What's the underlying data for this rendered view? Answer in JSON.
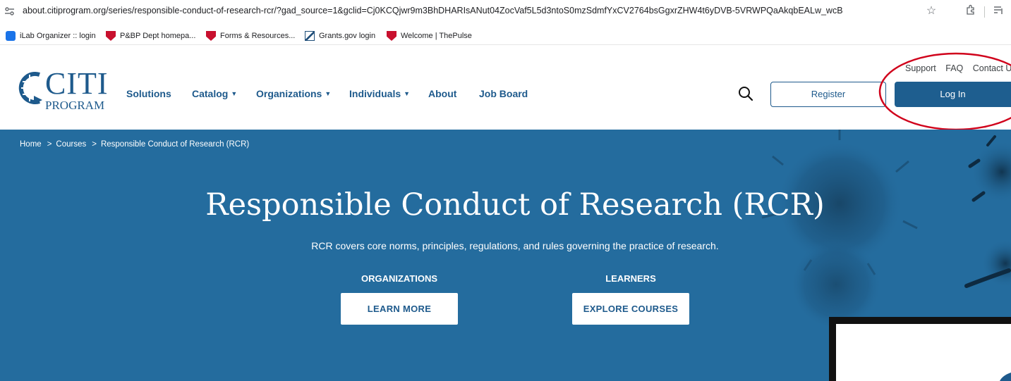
{
  "browser": {
    "url": "about.citiprogram.org/series/responsible-conduct-of-research-rcr/?gad_source=1&gclid=Cj0KCQjwr9m3BhDHARIsANut04ZocVaf5L5d3ntoS0mzSdmfYxCV2764bsGgxrZHW4t6yDVB-5VRWPQaAkqbEALw_wcB",
    "bookmarks": [
      {
        "label": "iLab Organizer :: login",
        "icon": "ilab-icon"
      },
      {
        "label": "P&BP Dept homepa...",
        "icon": "shield-icon"
      },
      {
        "label": "Forms & Resources...",
        "icon": "shield-icon"
      },
      {
        "label": "Grants.gov login",
        "icon": "grants-icon"
      },
      {
        "label": "Welcome | ThePulse",
        "icon": "shield-icon"
      }
    ]
  },
  "header": {
    "logo_main": "CITI",
    "logo_sub": "PROGRAM",
    "nav": [
      {
        "label": "Solutions",
        "dropdown": false
      },
      {
        "label": "Catalog",
        "dropdown": true
      },
      {
        "label": "Organizations",
        "dropdown": true
      },
      {
        "label": "Individuals",
        "dropdown": true
      },
      {
        "label": "About",
        "dropdown": false
      },
      {
        "label": "Job Board",
        "dropdown": false
      }
    ],
    "utility": {
      "support": "Support",
      "faq": "FAQ",
      "contact": "Contact Us"
    },
    "register_label": "Register",
    "login_label": "Log In"
  },
  "hero": {
    "breadcrumb": {
      "home": "Home",
      "courses": "Courses",
      "current": "Responsible Conduct of Research (RCR)",
      "separator": ">"
    },
    "title": "Responsible Conduct of Research (RCR)",
    "subtitle": "RCR covers core norms, principles, regulations, and rules governing the practice of research.",
    "organizations_label": "ORGANIZATIONS",
    "learn_more_label": "LEARN MORE",
    "learners_label": "LEARNERS",
    "explore_label": "EXPLORE COURSES"
  },
  "colors": {
    "brand_blue": "#1e5a8c",
    "hero_blue": "#246c9e",
    "annotation_red": "#d0021b"
  }
}
